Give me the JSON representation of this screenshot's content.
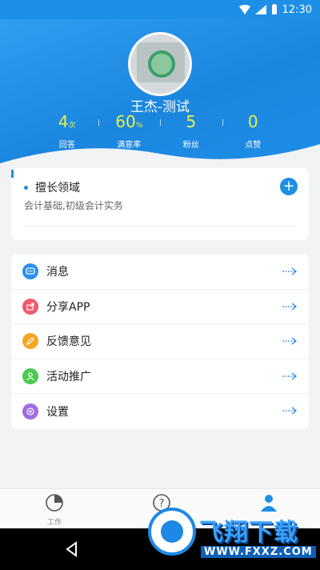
{
  "status_bar": {
    "time": "12:30"
  },
  "profile": {
    "name": "王杰-测试"
  },
  "stats": [
    {
      "value": "4",
      "unit": "次",
      "label": "回答"
    },
    {
      "value": "60",
      "unit": "%",
      "label": "满意率"
    },
    {
      "value": "5",
      "unit": "",
      "label": "粉丝"
    },
    {
      "value": "0",
      "unit": "",
      "label": "点赞"
    }
  ],
  "expertise": {
    "title": "擅长领域",
    "content": "会计基础,初级会计实务"
  },
  "menu": [
    {
      "label": "消息",
      "icon": "chat-icon",
      "color": "#2b8ff0"
    },
    {
      "label": "分享APP",
      "icon": "share-icon",
      "color": "#f15a6b"
    },
    {
      "label": "反馈意见",
      "icon": "pencil-icon",
      "color": "#f5a623"
    },
    {
      "label": "活动推广",
      "icon": "person-icon",
      "color": "#4cc94f"
    },
    {
      "label": "设置",
      "icon": "target-icon",
      "color": "#a06ce0"
    }
  ],
  "tabs": [
    {
      "label": "工作",
      "icon": "pie-chart-icon"
    },
    {
      "label": "",
      "icon": "question-icon"
    },
    {
      "label": "",
      "icon": "user-icon"
    }
  ],
  "watermark": {
    "text": "飞翔下载",
    "site": "WWW.FXXZ.COM"
  },
  "colors": {
    "primary": "#1d8fe6",
    "stat_value": "#e6f14a"
  }
}
